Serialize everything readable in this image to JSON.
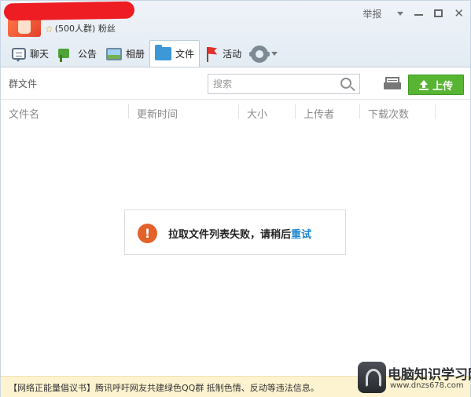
{
  "header": {
    "group_info": "(500人群) 粉丝",
    "report_label": "举报",
    "window_controls": [
      "dropdown",
      "minimize",
      "maximize",
      "close"
    ]
  },
  "tabs": [
    {
      "label": "聊天",
      "icon": "chat-icon"
    },
    {
      "label": "公告",
      "icon": "notice-icon"
    },
    {
      "label": "相册",
      "icon": "photo-icon"
    },
    {
      "label": "文件",
      "icon": "folder-icon",
      "active": true
    },
    {
      "label": "活动",
      "icon": "flag-icon"
    }
  ],
  "toolbar": {
    "title": "群文件",
    "search_placeholder": "搜索",
    "upload_label": "上传"
  },
  "columns": [
    "文件名",
    "更新时间",
    "大小",
    "上传者",
    "下载次数"
  ],
  "error": {
    "message": "拉取文件列表失败，请稍后",
    "retry_label": "重试"
  },
  "footer": {
    "notice": "【网络正能量倡议书】腾讯呼吁网友共建绿色QQ群 抵制色情、反动等违法信息。"
  },
  "watermark": {
    "title": "电脑知识学习网",
    "url": "www.dnzs678.com"
  },
  "colors": {
    "upload_green": "#57b533",
    "retry_blue": "#1c86d0",
    "error_orange": "#e2622a",
    "footer_bg": "#fdf3d0"
  }
}
